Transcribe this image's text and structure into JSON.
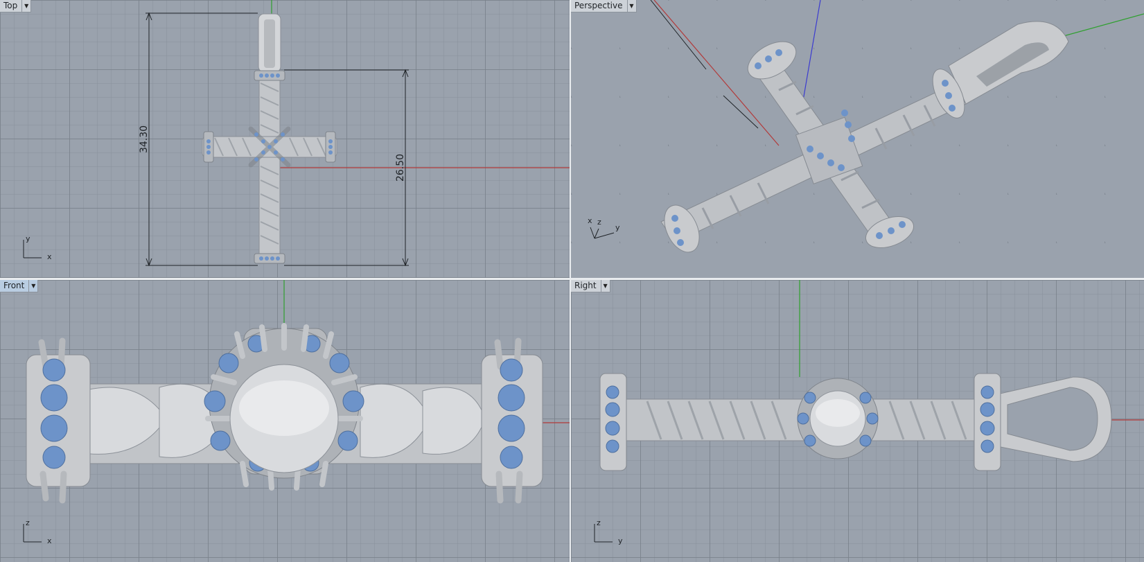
{
  "viewports": {
    "top": {
      "label": "Top",
      "axis_h": "x",
      "axis_v": "y"
    },
    "perspective": {
      "label": "Perspective",
      "axis_x": "x",
      "axis_z": "z",
      "axis_y": "y"
    },
    "front": {
      "label": "Front",
      "axis_h": "x",
      "axis_v": "z"
    },
    "right": {
      "label": "Right",
      "axis_h": "y",
      "axis_v": "z"
    }
  },
  "dimensions": {
    "overall_height": "34.30",
    "cross_height": "26.50"
  },
  "colors": {
    "viewport_bg": "#9aa2ad",
    "x_axis": "#b23a3a",
    "y_axis": "#2fa02f",
    "z_axis": "#3b3bd0",
    "metal": "#c8cacd",
    "gem": "#6d93c9"
  },
  "icons": {
    "dropdown": "chevron-down-icon"
  }
}
